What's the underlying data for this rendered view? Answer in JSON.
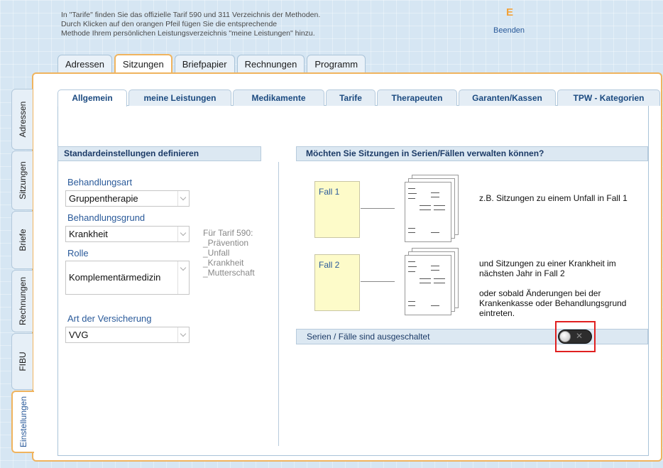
{
  "header": {
    "info_lines": [
      "In \"Tarife\" finden Sie das offizielle Tarif 590 und 311 Verzeichnis der Methoden.",
      "Durch Klicken auf den orangen Pfeil fügen Sie die entsprechende",
      "Methode Ihrem persönlichen Leistungsverzeichnis \"meine Leistungen\" hinzu."
    ],
    "logo_letter": "E",
    "quit_label": "Beenden"
  },
  "top_tabs": [
    "Adressen",
    "Sitzungen",
    "Briefpapier",
    "Rechnungen",
    "Programm"
  ],
  "side_tabs": [
    "Adressen",
    "Sitzungen",
    "Briefe",
    "Rechnungen",
    "FIBU",
    "Einstellungen"
  ],
  "sub_tabs": [
    "Allgemein",
    "meine Leistungen",
    "Medikamente",
    "Tarife",
    "Therapeuten",
    "Garanten/Kassen",
    "TPW - Kategorien"
  ],
  "left": {
    "heading": "Standardeinstellungen definieren",
    "behandlungsart_label": "Behandlungsart",
    "behandlungsart_value": "Gruppentherapie",
    "behandlungsgrund_label": "Behandlungsgrund",
    "behandlungsgrund_value": "Krankheit",
    "rolle_label": "Rolle",
    "rolle_value": "Komplementärmedizin",
    "versicherung_label": "Art der Versicherung",
    "versicherung_value": "VVG",
    "hint_lines": [
      "Für Tarif 590:",
      "_Prävention",
      "_Unfall",
      "_Krankheit",
      "_Mutterschaft"
    ]
  },
  "right": {
    "heading": "Möchten Sie Sitzungen in Serien/Fällen verwalten können?",
    "fall1": "Fall 1",
    "fall2": "Fall 2",
    "desc1": "z.B. Sitzungen zu einem Unfall in Fall 1",
    "desc2_lines": [
      "und Sitzungen zu einer Krankheit im",
      "nächsten Jahr in Fall 2"
    ],
    "desc3_lines": [
      "oder sobald Änderungen bei der",
      "Krankenkasse oder Behandlungsgrund",
      "eintreten."
    ],
    "series_status": "Serien / Fälle sind ausgeschaltet",
    "toggle_on": false,
    "toggle_symbol": "✕"
  },
  "colors": {
    "accent": "#f0b45e",
    "highlight": "#e02020",
    "link": "#2a5a9a",
    "case_box": "#fdfbc9"
  }
}
